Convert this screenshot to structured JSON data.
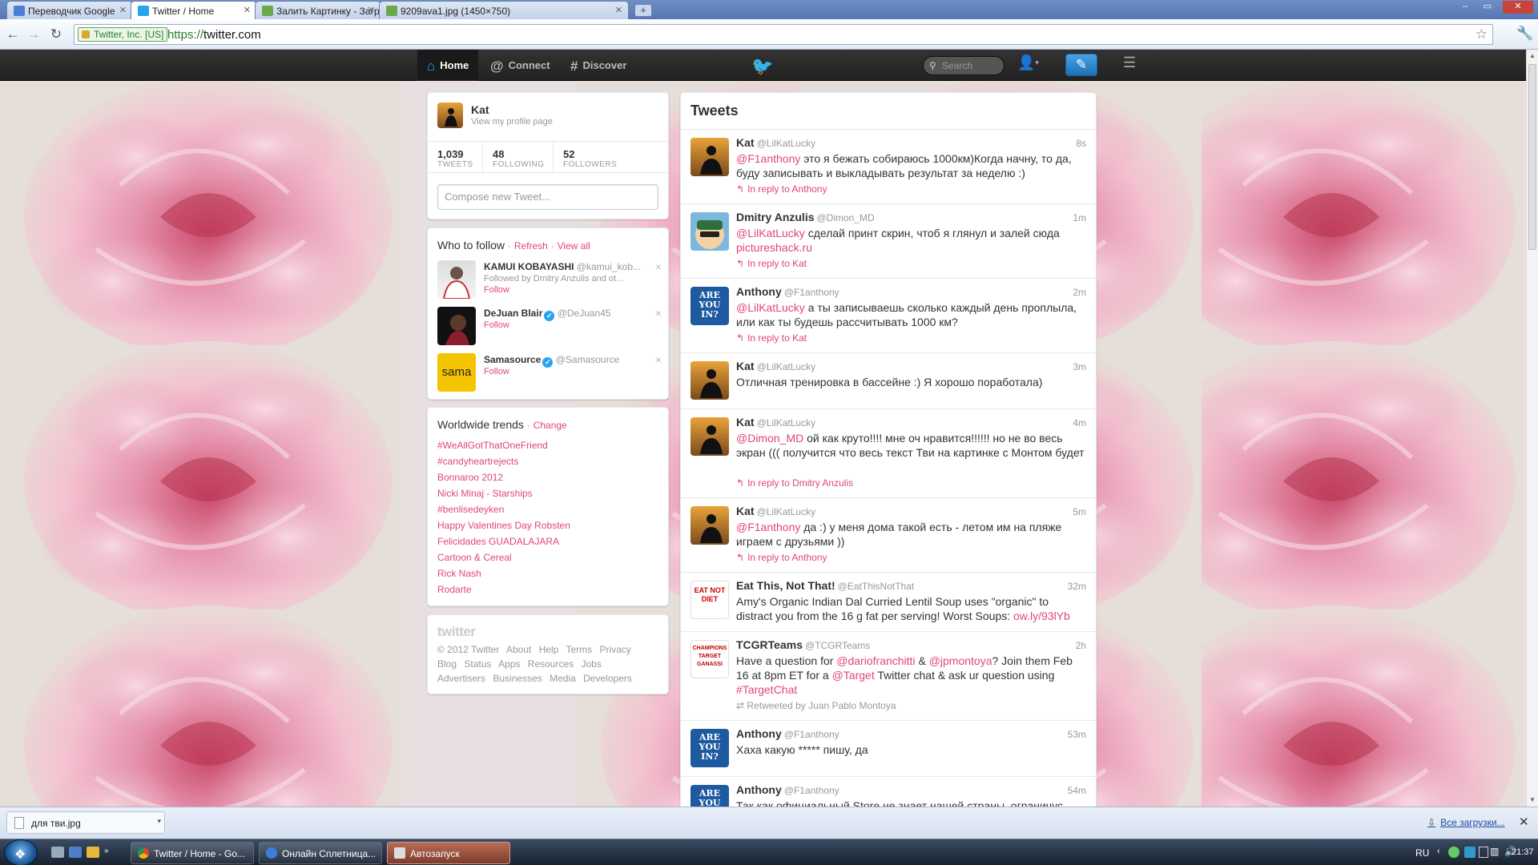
{
  "browser": {
    "tabs": [
      {
        "label": "Переводчик Google",
        "favicon_color": "#4a7fd6"
      },
      {
        "label": "Twitter / Home",
        "favicon_color": "#2aa3ef"
      },
      {
        "label": "Залить Картинку - Загрузи",
        "favicon_color": "#6aa84f"
      },
      {
        "label": "9209ava1.jpg (1450×750)",
        "favicon_color": "#6aa84f"
      }
    ],
    "new_tab_label": "+",
    "window_controls": {
      "minimize": "–",
      "restore": "▭",
      "close": "✕"
    },
    "ev_cert": "Twitter, Inc. [US]",
    "url_scheme": "https://",
    "url_host": "twitter.com"
  },
  "twitter_nav": {
    "home": "Home",
    "connect": "Connect",
    "discover": "Discover",
    "search_placeholder": "Search",
    "icons": {
      "home": "home-icon",
      "connect": "at-icon",
      "discover": "hash-icon",
      "bird": "bird-logo-icon",
      "compose": "compose-icon",
      "settings": "settings-icon"
    }
  },
  "profile": {
    "name": "Kat",
    "link": "View my profile page",
    "tweets_count": "1,039",
    "tweets_label": "TWEETS",
    "following_count": "48",
    "following_label": "FOLLOWING",
    "followers_count": "52",
    "followers_label": "FOLLOWERS",
    "compose_placeholder": "Compose new Tweet..."
  },
  "who_to_follow": {
    "title": "Who to follow",
    "refresh": "Refresh",
    "view_all": "View all",
    "sep": "·",
    "items": [
      {
        "name": "KAMUI KOBAYASHI",
        "handle": "@kamui_kob...",
        "sub": "Followed by Dmitry Anzulis and ot...",
        "follow": "Follow"
      },
      {
        "name": "DeJuan Blair",
        "handle": "@DeJuan45",
        "sub": "",
        "follow": "Follow"
      },
      {
        "name": "Samasource",
        "handle": "@Samasource",
        "sub": "",
        "follow": "Follow",
        "avatar_text": "sama"
      }
    ]
  },
  "trends": {
    "title": "Worldwide trends",
    "change": "Change",
    "items": [
      "#WeAllGotThatOneFriend",
      "#candyheartrejects",
      "Bonnaroo 2012",
      "Nicki Minaj - Starships",
      "#benlisedeyken",
      "Happy Valentines Day Robsten",
      "Felicidades GUADALAJARA",
      "Cartoon & Cereal",
      "Rick Nash",
      "Rodarte"
    ]
  },
  "footer": {
    "logo": "twitter",
    "line1": [
      "© 2012 Twitter",
      "About",
      "Help",
      "Terms",
      "Privacy"
    ],
    "line2": [
      "Blog",
      "Status",
      "Apps",
      "Resources",
      "Jobs"
    ],
    "line3": [
      "Advertisers",
      "Businesses",
      "Media",
      "Developers"
    ]
  },
  "stream": {
    "title": "Tweets",
    "tweets": [
      {
        "name": "Kat",
        "handle": "@LilKatLucky",
        "time": "8s",
        "text_html": "<a>@F1anthony</a> это я бежать собираюсь 1000км)Когда начну, то да, буду записывать и выкладывать результат за неделю :)",
        "reply": "In reply to Anthony"
      },
      {
        "name": "Dmitry Anzulis",
        "handle": "@Dimon_MD",
        "time": "1m",
        "text_html": "<a>@LilKatLucky</a> сделай принт скрин, чтоб я глянул и залей сюда <a>pictureshack.ru</a>",
        "reply": "In reply to Kat"
      },
      {
        "name": "Anthony",
        "handle": "@F1anthony",
        "time": "2m",
        "text_html": "<a>@LilKatLucky</a> а ты записываешь сколько каждый день проплыла, или как ты будешь рассчитывать 1000 км?",
        "reply": "In reply to Kat"
      },
      {
        "name": "Kat",
        "handle": "@LilKatLucky",
        "time": "3m",
        "text_html": "Отличная тренировка в бассейне :) Я хорошо поработала)",
        "reply": ""
      },
      {
        "name": "Kat",
        "handle": "@LilKatLucky",
        "time": "4m",
        "text_html": "<a>@Dimon_MD</a> ой как круто!!!! мне оч нравится!!!!!! но не во весь экран ((( получится что весь текст Тви на картинке с Монтом будет",
        "reply": "In reply to Dmitry Anzulis"
      },
      {
        "name": "Kat",
        "handle": "@LilKatLucky",
        "time": "5m",
        "text_html": "<a>@F1anthony</a> да :) у меня дома такой есть - летом им на пляже играем с друзьями ))",
        "reply": "In reply to Anthony"
      },
      {
        "name": "Eat This, Not That!",
        "handle": "@EatThisNotThat",
        "time": "32m",
        "text_html": "Amy's Organic Indian Dal Curried Lentil Soup uses \"organic\" to distract you from the 16 g fat per serving! Worst Soups: <a>ow.ly/93lYb</a>",
        "reply": ""
      },
      {
        "name": "TCGRTeams",
        "handle": "@TCGRTeams",
        "time": "2h",
        "text_html": "Have a question for <a>@dariofranchitti</a> &amp; <a>@jpmontoya</a>? Join them Feb 16 at 8pm ET for a <a>@Target</a> Twitter chat &amp; ask ur question using <a>#TargetChat</a>",
        "reply": "",
        "retweet": "Retweeted by Juan Pablo Montoya"
      },
      {
        "name": "Anthony",
        "handle": "@F1anthony",
        "time": "53m",
        "text_html": "Хаха какую ***** пишу, да",
        "reply": ""
      },
      {
        "name": "Anthony",
        "handle": "@F1anthony",
        "time": "54m",
        "text_html": "Так как официальный Store не знает нашей страны, ограничус",
        "reply": ""
      }
    ]
  },
  "avatar_text": {
    "are_you_in": "ARE YOU IN?",
    "eat": "EAT NOT DIET",
    "tcgr": "CHAMPIONS TARGET GANASSI"
  },
  "download_bar": {
    "file": "для тви.jpg",
    "all_downloads": "Все загрузки..."
  },
  "taskbar": {
    "tasks": [
      {
        "label": "Twitter / Home - Go...",
        "color": "#e2a13b"
      },
      {
        "label": "Онлайн Сплетница...",
        "color": "#3b7fd9"
      },
      {
        "label": "Автозапуск",
        "color": "#c94"
      }
    ],
    "lang": "RU",
    "time": "21:37"
  }
}
